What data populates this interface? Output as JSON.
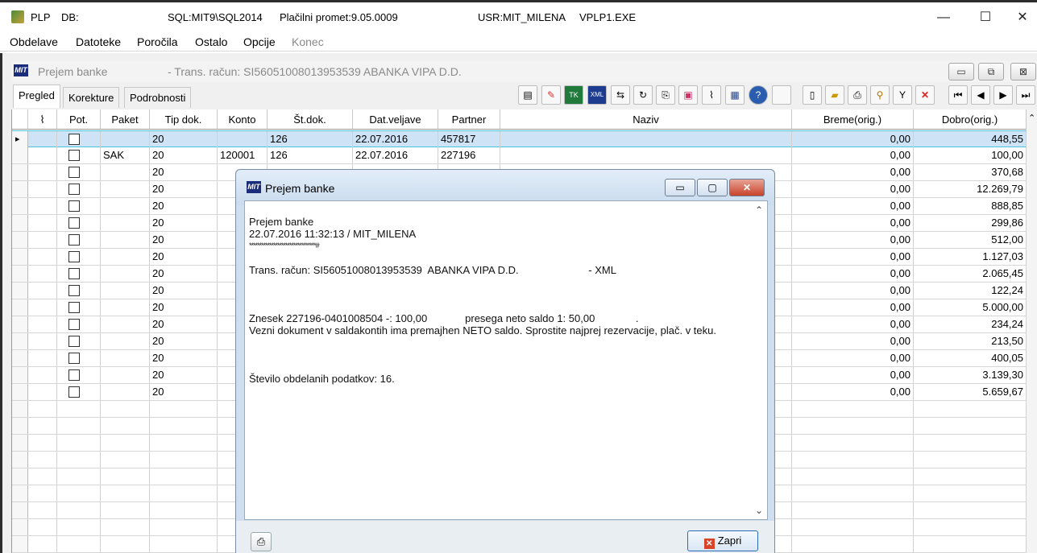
{
  "titlebar": {
    "app": "PLP",
    "db": "DB:",
    "sql": "SQL:MIT9\\SQL2014",
    "module": "Plačilni promet:9.05.0009",
    "user": "USR:MIT_MILENA",
    "exe": "VPLP1.EXE",
    "minimize": "—",
    "maximize": "☐",
    "close": "✕"
  },
  "menu": [
    "Obdelave",
    "Datoteke",
    "Poročila",
    "Ostalo",
    "Opcije",
    "Konec"
  ],
  "child": {
    "logo": "MIT",
    "title": "Prejem banke",
    "subtitle": "- Trans. račun: SI56051008013953539  ABANKA VIPA D.D."
  },
  "tabs": [
    "Pregled",
    "Korekture",
    "Podrobnosti"
  ],
  "grid": {
    "headers": [
      "Pot.",
      "Paket",
      "Tip dok.",
      "Konto",
      "Št.dok.",
      "Dat.veljave",
      "Partner",
      "Naziv",
      "Breme(orig.)",
      "Dobro(orig.)"
    ],
    "rows": [
      {
        "paket": "",
        "tip": "20",
        "konto": "",
        "stdok": "126",
        "datum": "22.07.2016",
        "partner": "457817",
        "breme": "0,00",
        "dobro": "448,55"
      },
      {
        "paket": "SAK",
        "tip": "20",
        "konto": "120001",
        "stdok": "126",
        "datum": "22.07.2016",
        "partner": "227196",
        "breme": "0,00",
        "dobro": "100,00"
      },
      {
        "paket": "",
        "tip": "20",
        "konto": "",
        "stdok": "",
        "datum": "",
        "partner": "",
        "breme": "0,00",
        "dobro": "370,68"
      },
      {
        "paket": "",
        "tip": "20",
        "konto": "",
        "stdok": "",
        "datum": "",
        "partner": "",
        "breme": "0,00",
        "dobro": "12.269,79"
      },
      {
        "paket": "",
        "tip": "20",
        "konto": "",
        "stdok": "",
        "datum": "",
        "partner": "",
        "breme": "0,00",
        "dobro": "888,85"
      },
      {
        "paket": "",
        "tip": "20",
        "konto": "",
        "stdok": "",
        "datum": "",
        "partner": "",
        "breme": "0,00",
        "dobro": "299,86"
      },
      {
        "paket": "",
        "tip": "20",
        "konto": "",
        "stdok": "",
        "datum": "",
        "partner": "",
        "breme": "0,00",
        "dobro": "512,00"
      },
      {
        "paket": "",
        "tip": "20",
        "konto": "",
        "stdok": "",
        "datum": "",
        "partner": "",
        "breme": "0,00",
        "dobro": "1.127,03"
      },
      {
        "paket": "",
        "tip": "20",
        "konto": "",
        "stdok": "",
        "datum": "",
        "partner": "",
        "breme": "0,00",
        "dobro": "2.065,45"
      },
      {
        "paket": "",
        "tip": "20",
        "konto": "",
        "stdok": "",
        "datum": "",
        "partner": "",
        "breme": "0,00",
        "dobro": "122,24"
      },
      {
        "paket": "",
        "tip": "20",
        "konto": "",
        "stdok": "",
        "datum": "",
        "partner": "",
        "breme": "0,00",
        "dobro": "5.000,00"
      },
      {
        "paket": "",
        "tip": "20",
        "konto": "",
        "stdok": "",
        "datum": "",
        "partner": "",
        "breme": "0,00",
        "dobro": "234,24"
      },
      {
        "paket": "",
        "tip": "20",
        "konto": "",
        "stdok": "",
        "datum": "",
        "partner": "",
        "breme": "0,00",
        "dobro": "213,50"
      },
      {
        "paket": "",
        "tip": "20",
        "konto": "",
        "stdok": "",
        "datum": "",
        "partner": "",
        "breme": "0,00",
        "dobro": "400,05"
      },
      {
        "paket": "",
        "tip": "20",
        "konto": "",
        "stdok": "",
        "datum": "",
        "partner": "",
        "breme": "0,00",
        "dobro": "3.139,30"
      },
      {
        "paket": "",
        "tip": "20",
        "konto": "",
        "stdok": "",
        "datum": "",
        "partner": "",
        "breme": "0,00",
        "dobro": "5.659,67"
      }
    ]
  },
  "dialog": {
    "logo": "MIT",
    "title": "Prejem banke",
    "lines": [
      "Prejem banke",
      "22.07.2016 11:32:13 / MIT_MILENA",
      "*********************************#",
      "",
      "Trans. račun: SI56051008013953539  ABANKA VIPA D.D.                        - XML",
      "",
      "",
      "",
      "Znesek 227196-0401008504 -: 100,00             presega neto saldo 1: 50,00              .",
      "Vezni dokument v saldakontih ima premajhen NETO saldo. Sprostite najprej rezervacije, plač. v teku.",
      "",
      "",
      "",
      "Število obdelanih podatkov: 16."
    ],
    "close_label": "Zapri"
  }
}
